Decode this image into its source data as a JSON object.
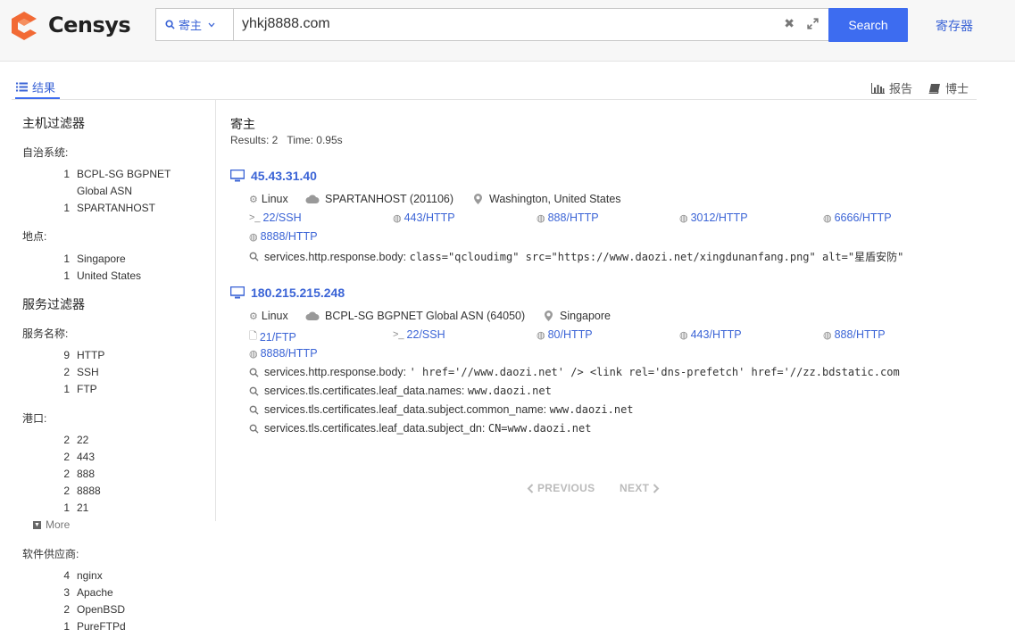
{
  "header": {
    "brand": "Censys",
    "scope_label": "寄主",
    "query_value": "yhkj8888.com",
    "search_label": "Search",
    "storage_link": "寄存器"
  },
  "tabs": {
    "results_label": "结果",
    "report_label": "报告",
    "docs_label": "博士"
  },
  "sidebar": {
    "host_filters_title": "主机过滤器",
    "as_label": "自治系统:",
    "as_items": [
      {
        "count": "1",
        "label": "BCPL-SG BGPNET Global ASN"
      },
      {
        "count": "1",
        "label": "SPARTANHOST"
      }
    ],
    "location_label": "地点:",
    "location_items": [
      {
        "count": "1",
        "label": "Singapore"
      },
      {
        "count": "1",
        "label": "United States"
      }
    ],
    "service_filters_title": "服务过滤器",
    "service_name_label": "服务名称:",
    "service_items": [
      {
        "count": "9",
        "label": "HTTP"
      },
      {
        "count": "2",
        "label": "SSH"
      },
      {
        "count": "1",
        "label": "FTP"
      }
    ],
    "port_label": "港口:",
    "port_items": [
      {
        "count": "2",
        "label": "22"
      },
      {
        "count": "2",
        "label": "443"
      },
      {
        "count": "2",
        "label": "888"
      },
      {
        "count": "2",
        "label": "8888"
      },
      {
        "count": "1",
        "label": "21"
      }
    ],
    "more_label": "More",
    "vendor_label": "软件供应商:",
    "vendor_items": [
      {
        "count": "4",
        "label": "nginx"
      },
      {
        "count": "3",
        "label": "Apache"
      },
      {
        "count": "2",
        "label": "OpenBSD"
      },
      {
        "count": "1",
        "label": "PureFTPd"
      }
    ]
  },
  "results": {
    "title": "寄主",
    "count_text": "Results: 2",
    "time_text": "Time: 0.95s",
    "hosts": [
      {
        "ip": "45.43.31.40",
        "os": "Linux",
        "asn": "SPARTANHOST (201106)",
        "location": "Washington, United States",
        "services": [
          "22/SSH",
          "443/HTTP",
          "888/HTTP",
          "3012/HTTP",
          "6666/HTTP",
          "8888/HTTP"
        ],
        "matches": [
          {
            "field": "services.http.response.body:",
            "value": "class=\"qcloudimg\" src=\"https://www.daozi.net/xingdunanfang.png\" alt=\"星盾安防\""
          }
        ]
      },
      {
        "ip": "180.215.215.248",
        "os": "Linux",
        "asn": "BCPL-SG BGPNET Global ASN (64050)",
        "location": "Singapore",
        "services": [
          "21/FTP",
          "22/SSH",
          "80/HTTP",
          "443/HTTP",
          "888/HTTP",
          "8888/HTTP"
        ],
        "matches": [
          {
            "field": "services.http.response.body:",
            "value": "' href='//www.daozi.net' /> <link rel='dns-prefetch' href='//zz.bdstatic.com"
          },
          {
            "field": "services.tls.certificates.leaf_data.names:",
            "value": "www.daozi.net"
          },
          {
            "field": "services.tls.certificates.leaf_data.subject.common_name:",
            "value": "www.daozi.net"
          },
          {
            "field": "services.tls.certificates.leaf_data.subject_dn:",
            "value": "CN=www.daozi.net"
          }
        ]
      }
    ]
  },
  "pagination": {
    "previous_label": "PREVIOUS",
    "next_label": "NEXT"
  },
  "colors": {
    "accent": "#3d6cf0",
    "link": "#3b64d6",
    "logo_orange": "#f26a35"
  }
}
